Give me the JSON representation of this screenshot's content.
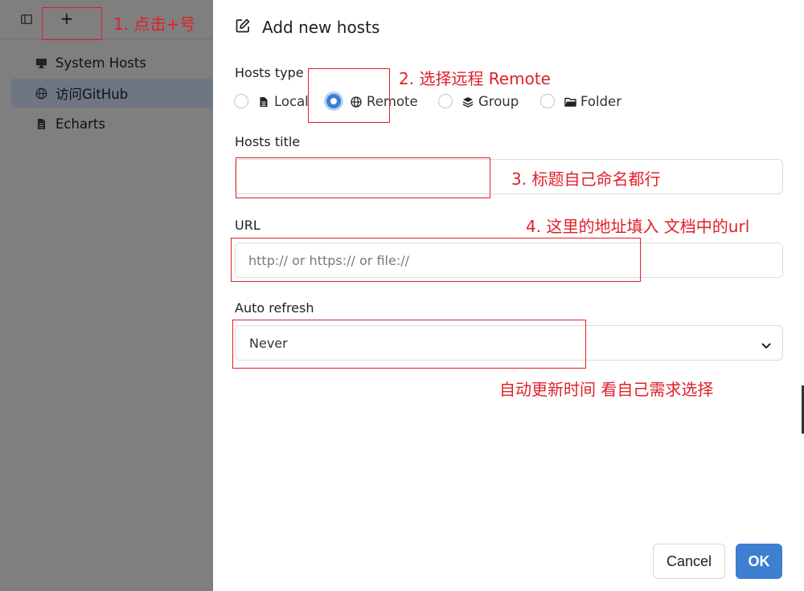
{
  "sidebar": {
    "items": [
      {
        "label": "System Hosts",
        "icon": "monitor-icon"
      },
      {
        "label": "访问GitHub",
        "icon": "globe-icon",
        "active": true
      },
      {
        "label": "Echarts",
        "icon": "document-icon"
      }
    ]
  },
  "toolbar": {
    "add_label": "+"
  },
  "dialog": {
    "title": "Add new hosts",
    "hosts_type": {
      "label": "Hosts type",
      "options": [
        {
          "label": "Local",
          "icon": "file-icon",
          "checked": false
        },
        {
          "label": "Remote",
          "icon": "globe-icon",
          "checked": true
        },
        {
          "label": "Group",
          "icon": "layers-icon",
          "checked": false
        },
        {
          "label": "Folder",
          "icon": "folder-icon",
          "checked": false
        }
      ]
    },
    "hosts_title": {
      "label": "Hosts title",
      "value": ""
    },
    "url": {
      "label": "URL",
      "placeholder": "http:// or https:// or file://",
      "value": ""
    },
    "auto_refresh": {
      "label": "Auto refresh",
      "value": "Never"
    },
    "cancel_label": "Cancel",
    "ok_label": "OK"
  },
  "annotations": {
    "step1": "1. 点击+号",
    "step2": "2. 选择远程 Remote",
    "step3": "3. 标题自己命名都行",
    "step4": "4. 这里的地址填入 文档中的url",
    "step5": "自动更新时间 看自己需求选择"
  },
  "colors": {
    "accent": "#3e7fd1",
    "annotation": "#e0202a",
    "overlay": "#7f7f7f"
  }
}
